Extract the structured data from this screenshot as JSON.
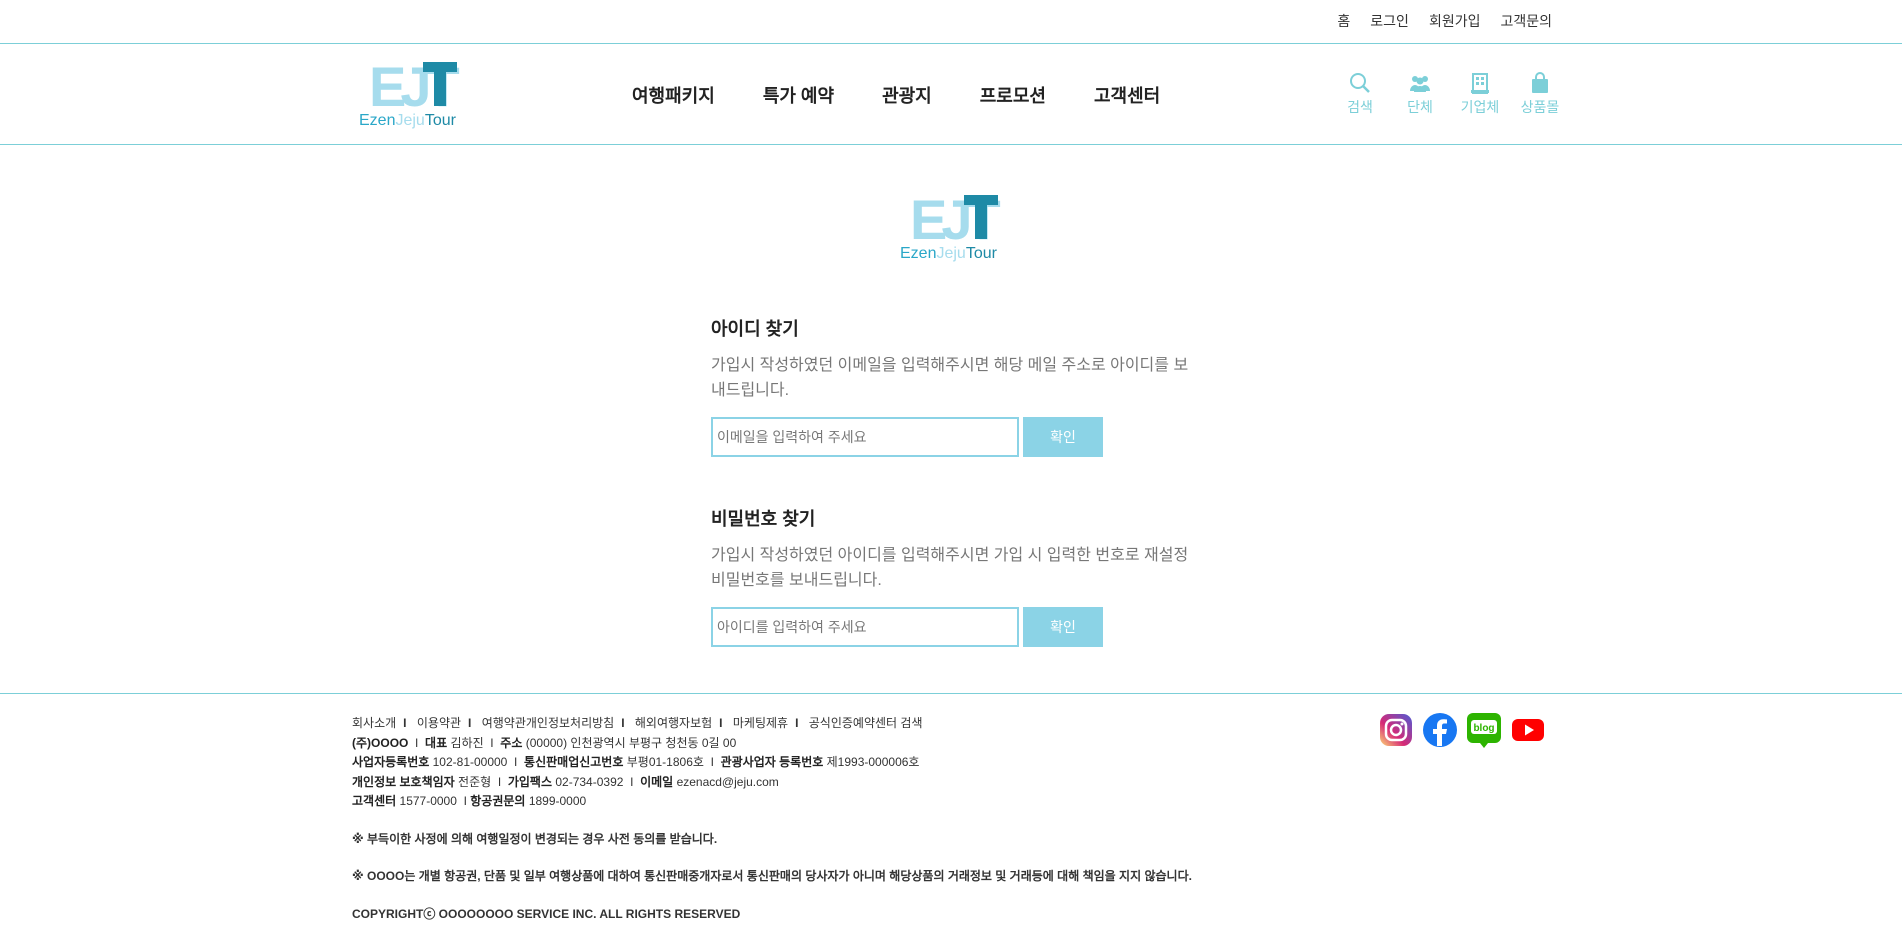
{
  "top_links": [
    "홈",
    "로그인",
    "회원가입",
    "고객문의"
  ],
  "brand": {
    "name": "Ezen Jeju Tour",
    "part1": "Ezen",
    "part2": "Jeju",
    "part3": "Tour",
    "mono": "EJT"
  },
  "nav": [
    "여행패키지",
    "특가 예약",
    "관광지",
    "프로모션",
    "고객센터"
  ],
  "header_icons": [
    {
      "label": "검색",
      "icon": "search-icon"
    },
    {
      "label": "단체",
      "icon": "group-icon"
    },
    {
      "label": "기업체",
      "icon": "building-icon"
    },
    {
      "label": "상품몰",
      "icon": "shopping-bag-icon"
    }
  ],
  "find_id": {
    "title": "아이디 찾기",
    "desc": "가입시 작성하였던 이메일을 입력해주시면 해당 메일 주소로 아이디를 보내드립니다.",
    "placeholder": "이메일을 입력하여 주세요",
    "button": "확인"
  },
  "find_pw": {
    "title": "비밀번호 찾기",
    "desc": "가입시 작성하였던 아이디를 입력해주시면 가입 시 입력한 번호로 재설정 비밀번호를 보내드립니다.",
    "placeholder": "아이디를 입력하여 주세요",
    "button": "확인"
  },
  "footer": {
    "links": [
      "회사소개",
      "이용약관",
      "여행약관개인정보처리방침",
      "해외여행자보험",
      "마케팅제휴",
      "공식인증예약센터 검색"
    ],
    "company": "(주)OOOO",
    "ceo_label": "대표",
    "ceo": "김하진",
    "addr_label": "주소",
    "addr": "(00000) 인천광역시 부평구 청천동 0길 00",
    "bizno_label": "사업자등록번호",
    "bizno": "102-81-00000",
    "mailorder_label": "통신판매업신고번호",
    "mailorder": "부평01-1806호",
    "tour_label": "관광사업자 등록번호",
    "tour": "제1993-000006호",
    "privacy_label": "개인정보 보호책임자",
    "privacy": "전준형",
    "fax_label": "가입팩스",
    "fax": "02-734-0392",
    "email_label": "이메일",
    "email": "ezenacd@jeju.com",
    "cs_label": "고객센터",
    "cs": "1577-0000",
    "air_label": "항공권문의",
    "air": "1899-0000",
    "note1": "※ 부득이한 사정에 의해 여행일정이 변경되는 경우 사전 동의를 받습니다.",
    "note2": "※ OOOO는 개별 항공권, 단품 및 일부 여행상품에 대하여 통신판매중개자로서 통신판매의 당사자가 아니며 해당상품의 거래정보 및 거래등에 대해 책임을 지지 않습니다.",
    "copyright": "COPYRIGHTⓒ OOOOOOOO SERVICE INC. ALL RIGHTS RESERVED"
  },
  "social": [
    {
      "name": "instagram-icon",
      "color": "#d62976"
    },
    {
      "name": "facebook-icon",
      "color": "#1877f2"
    },
    {
      "name": "blog-icon",
      "color": "#2db400",
      "text": "blog"
    },
    {
      "name": "youtube-icon",
      "color": "#ff0000"
    }
  ],
  "colors": {
    "accent": "#8bd3e6",
    "line": "#7ccfd8",
    "logo_dark": "#1e8aa6",
    "logo_light": "#a6dced"
  }
}
